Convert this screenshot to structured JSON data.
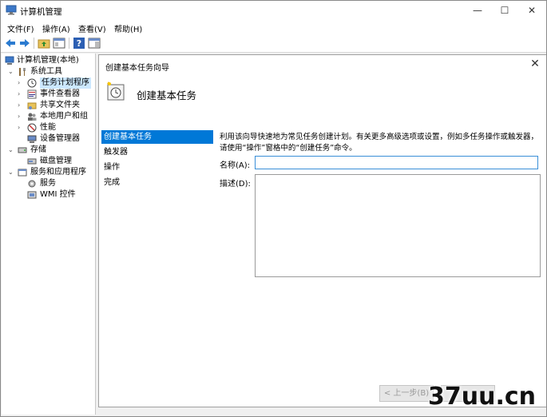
{
  "window": {
    "title": "计算机管理",
    "min": "—",
    "max": "☐",
    "close": "✕"
  },
  "menu": [
    "文件(F)",
    "操作(A)",
    "查看(V)",
    "帮助(H)"
  ],
  "tree": {
    "root": "计算机管理(本地)",
    "system_tools": "系统工具",
    "task_scheduler": "任务计划程序",
    "event_viewer": "事件查看器",
    "shared_folders": "共享文件夹",
    "local_users": "本地用户和组",
    "performance": "性能",
    "device_manager": "设备管理器",
    "storage": "存储",
    "disk_management": "磁盘管理",
    "services_apps": "服务和应用程序",
    "services": "服务",
    "wmi": "WMI 控件"
  },
  "dialog": {
    "title": "创建基本任务向导",
    "header": "创建基本任务",
    "steps": [
      "创建基本任务",
      "触发器",
      "操作",
      "完成"
    ],
    "intro": "利用该向导快速地为常见任务创建计划。有关更多高级选项或设置，例如多任务操作或触发器，请使用“操作”窗格中的“创建任务”命令。",
    "name_label": "名称(A):",
    "name_value": "",
    "desc_label": "描述(D):",
    "desc_value": "",
    "back_button": "< 上一步(B)"
  },
  "watermark": "37uu.cn",
  "colors": {
    "accent": "#0078d7",
    "selection": "#cce8ff"
  }
}
